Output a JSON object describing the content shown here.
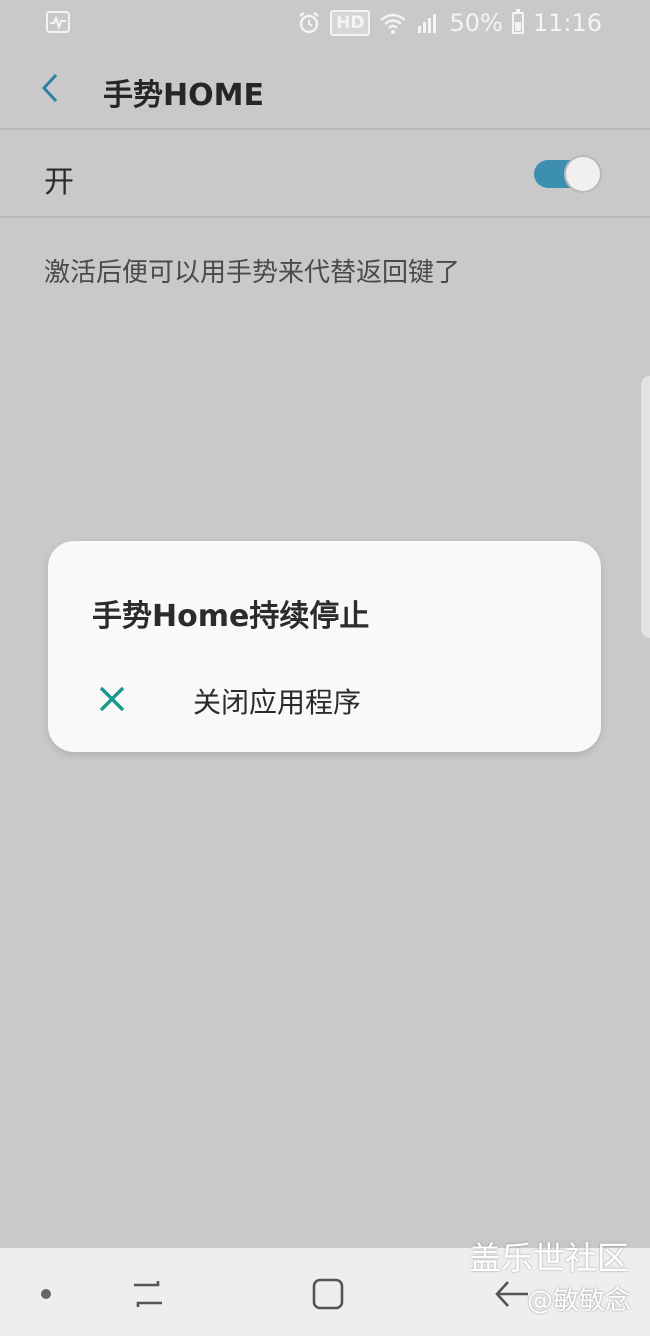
{
  "status_bar": {
    "hd_label": "HD",
    "battery": "50%",
    "battery_level": 0.5,
    "time": "11:16",
    "icons": [
      "activity-icon",
      "alarm-icon",
      "wifi-icon",
      "signal-icon",
      "battery-icon"
    ]
  },
  "header": {
    "title": "手势HOME",
    "back_icon": "chevron-left-icon"
  },
  "setting": {
    "label": "开",
    "enabled": true,
    "accent_color": "#3d8fb1",
    "description": "激活后便可以用手势来代替返回键了"
  },
  "dialog": {
    "title": "手势Home持续停止",
    "option": {
      "label": "关闭应用程序",
      "icon": "close-icon",
      "icon_color": "#1a9a8a"
    }
  },
  "nav_bar": {
    "buttons": [
      "dot-indicator",
      "recent-apps-icon",
      "home-icon",
      "back-icon"
    ]
  },
  "watermark": {
    "line1": "盖乐世社区",
    "line2": "@敏敏念"
  }
}
